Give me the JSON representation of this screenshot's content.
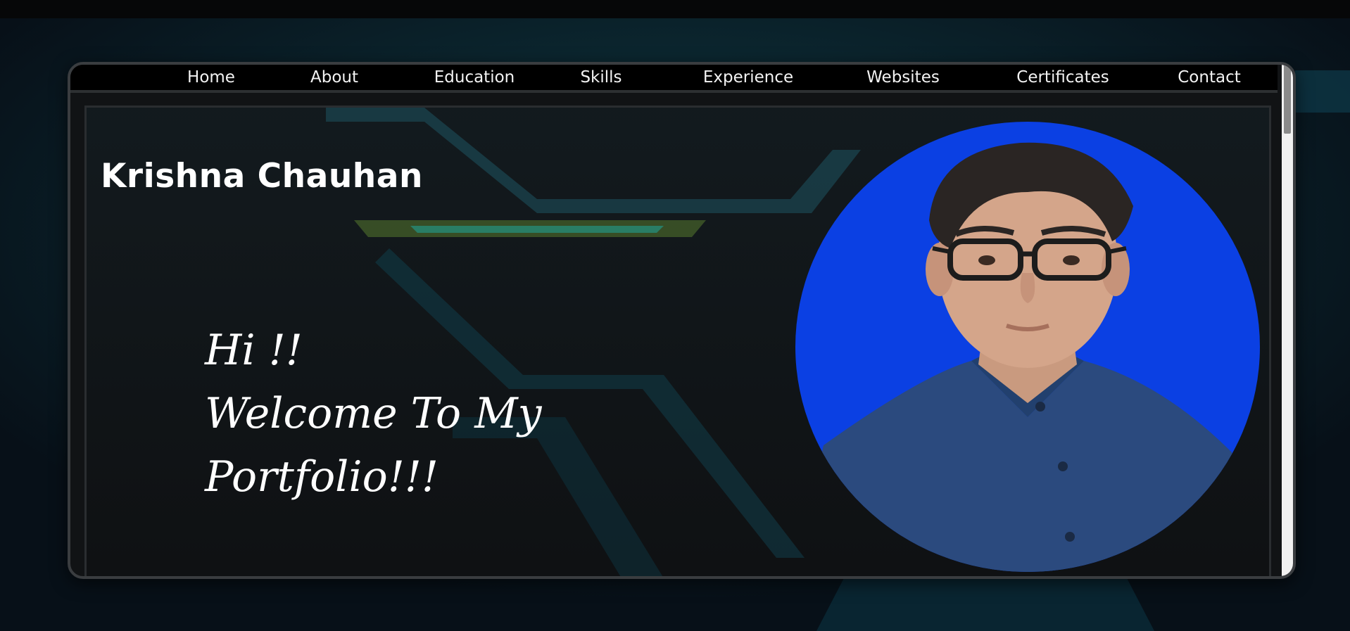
{
  "nav": {
    "items": [
      {
        "label": "Home"
      },
      {
        "label": "About"
      },
      {
        "label": "Education"
      },
      {
        "label": "Skills"
      },
      {
        "label": "Experience"
      },
      {
        "label": "Websites"
      },
      {
        "label": "Certificates"
      },
      {
        "label": "Contact"
      }
    ]
  },
  "hero": {
    "name": "Krishna Chauhan",
    "greeting_lines": [
      "Hi !!",
      "Welcome To My",
      "Portfolio!!!"
    ]
  },
  "profile": {
    "photo_icon": "profile-photo",
    "photo_bg_color": "#0b40e3"
  },
  "colors": {
    "page_bg": "#0a1620",
    "accent_teal": "#1fa59a",
    "accent_green": "#7fb13a",
    "nav_bg": "#000000"
  }
}
